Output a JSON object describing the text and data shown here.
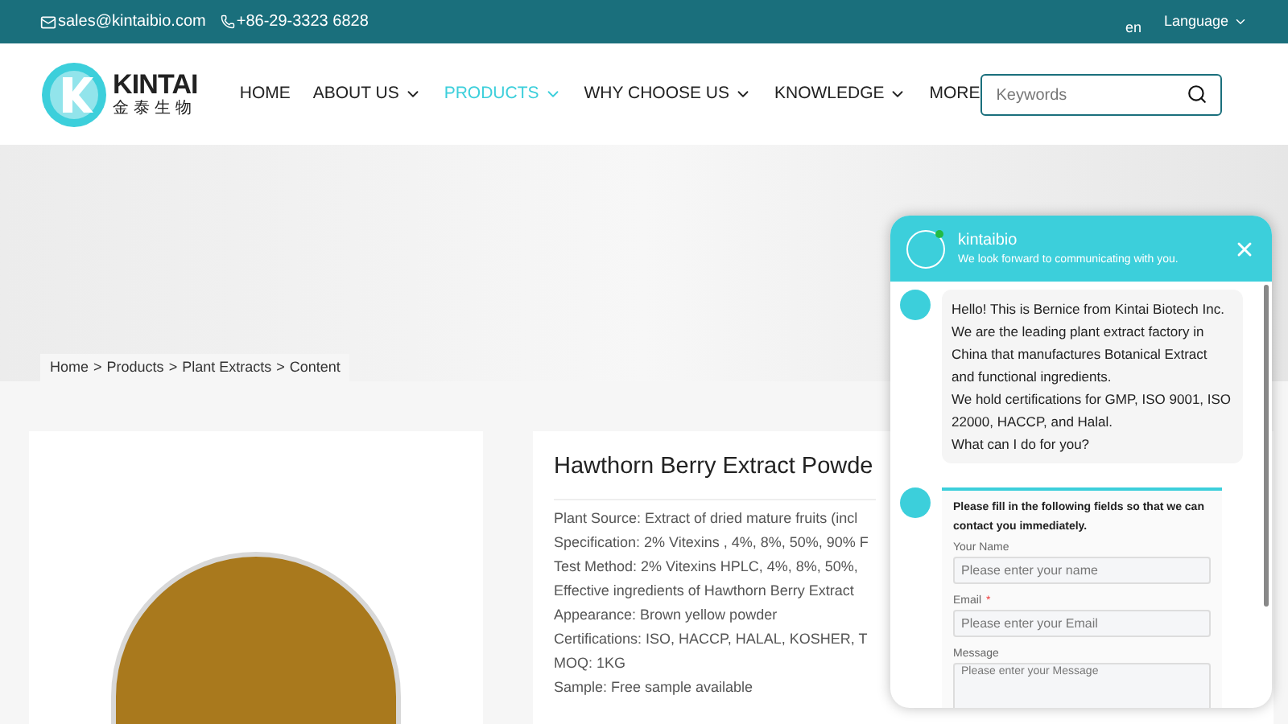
{
  "top_bar": {
    "email": "sales@kintaibio.com",
    "phone": "+86-29-3323 6828",
    "lang_code": "en",
    "language": "Language"
  },
  "logo": {
    "name": "KINTAI",
    "subtitle": "金泰生物"
  },
  "nav": [
    {
      "label": "HOME",
      "selected": false,
      "has_menu": false
    },
    {
      "label": "ABOUT US",
      "selected": false,
      "has_menu": true
    },
    {
      "label": "PRODUCTS",
      "selected": true,
      "has_menu": true
    },
    {
      "label": "WHY CHOOSE US",
      "selected": false,
      "has_menu": true
    },
    {
      "label": "KNOWLEDGE",
      "selected": false,
      "has_menu": true
    },
    {
      "label": "MORE",
      "selected": false,
      "has_menu": false
    }
  ],
  "search": {
    "placeholder": "Keywords"
  },
  "breadcrumb": [
    "Home",
    "Products",
    "Plant Extracts",
    "Content"
  ],
  "breadcrumb_separator": ">",
  "product": {
    "title": "Hawthorn Berry Extract Powde",
    "details": [
      "Plant Source: Extract of dried mature fruits (incl",
      "Specification: 2% Vitexins , 4%,  8%, 50%, 90% F",
      "Test Method: 2% Vitexins HPLC, 4%,  8%, 50%,",
      "Effective ingredients of Hawthorn Berry Extract",
      "Appearance: Brown yellow powder",
      "Certifications: ISO, HACCP, HALAL, KOSHER, T",
      "MOQ: 1KG",
      "Sample: Free sample available"
    ]
  },
  "chat": {
    "name": "kintaibio",
    "online": true,
    "tagline": "We look forward to communicating with you.",
    "greeting": [
      "Hello! This is Bernice from Kintai Biotech Inc.",
      "We are the leading plant extract factory in China that manufactures Botanical Extract and functional ingredients.",
      "We hold certifications for GMP, ISO 9001, ISO 22000, HACCP, and Halal.",
      "What can I do for you?"
    ],
    "required_symbol": "*",
    "form_intro": "Please fill in the following fields so that we can contact you immediately.",
    "fields": [
      {
        "label": "Your Name",
        "required": false,
        "placeholder": "Please enter your name",
        "kind": "input"
      },
      {
        "label": "Email",
        "required": true,
        "placeholder": "Please enter your Email",
        "kind": "input"
      },
      {
        "label": "Message",
        "required": false,
        "placeholder": "Please enter your Message",
        "kind": "textarea"
      }
    ]
  }
}
